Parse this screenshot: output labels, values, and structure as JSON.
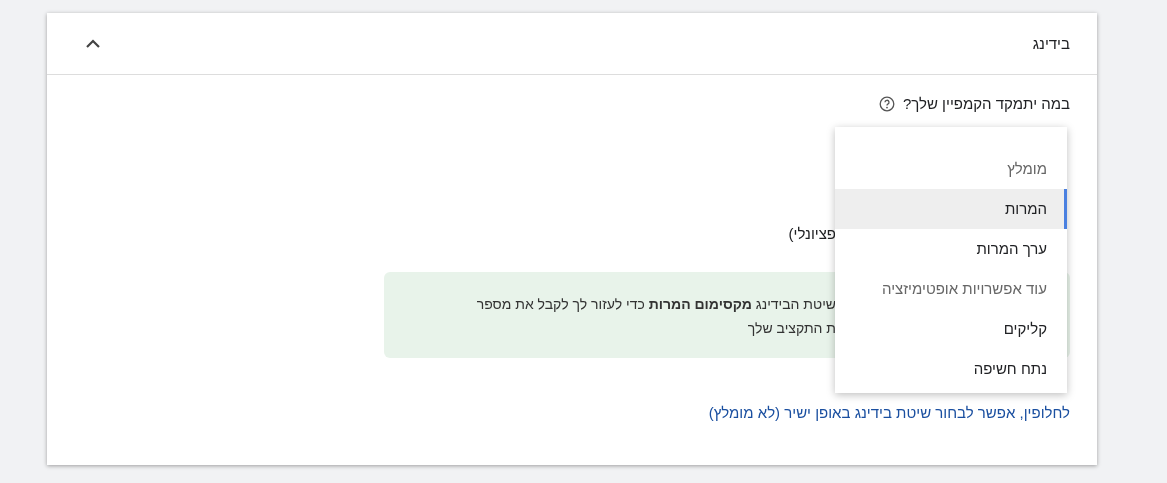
{
  "section": {
    "title": "בידינג",
    "expanded": true
  },
  "question": {
    "label": "במה יתמקד הקמפיין שלך?"
  },
  "partial_text": "פציונלי)",
  "info_box": {
    "lines": [
      "שיטת הבידינג **מקסימום המרות** כדי לעזור לך לקבל את מספר",
      "ת התקציב שלך"
    ]
  },
  "link": "לחלופין, אפשר לבחור שיטת בידינג באופן ישיר (לא מומלץ)",
  "dropdown": {
    "items": [
      {
        "kind": "header",
        "label": "מומלץ"
      },
      {
        "kind": "option",
        "label": "המרות",
        "selected": true
      },
      {
        "kind": "option",
        "label": "ערך המרות",
        "selected": false
      },
      {
        "kind": "header",
        "label": "עוד אפשרויות אופטימיזציה"
      },
      {
        "kind": "option",
        "label": "קליקים",
        "selected": false
      },
      {
        "kind": "option",
        "label": "נתח חשיפה",
        "selected": false
      }
    ]
  }
}
